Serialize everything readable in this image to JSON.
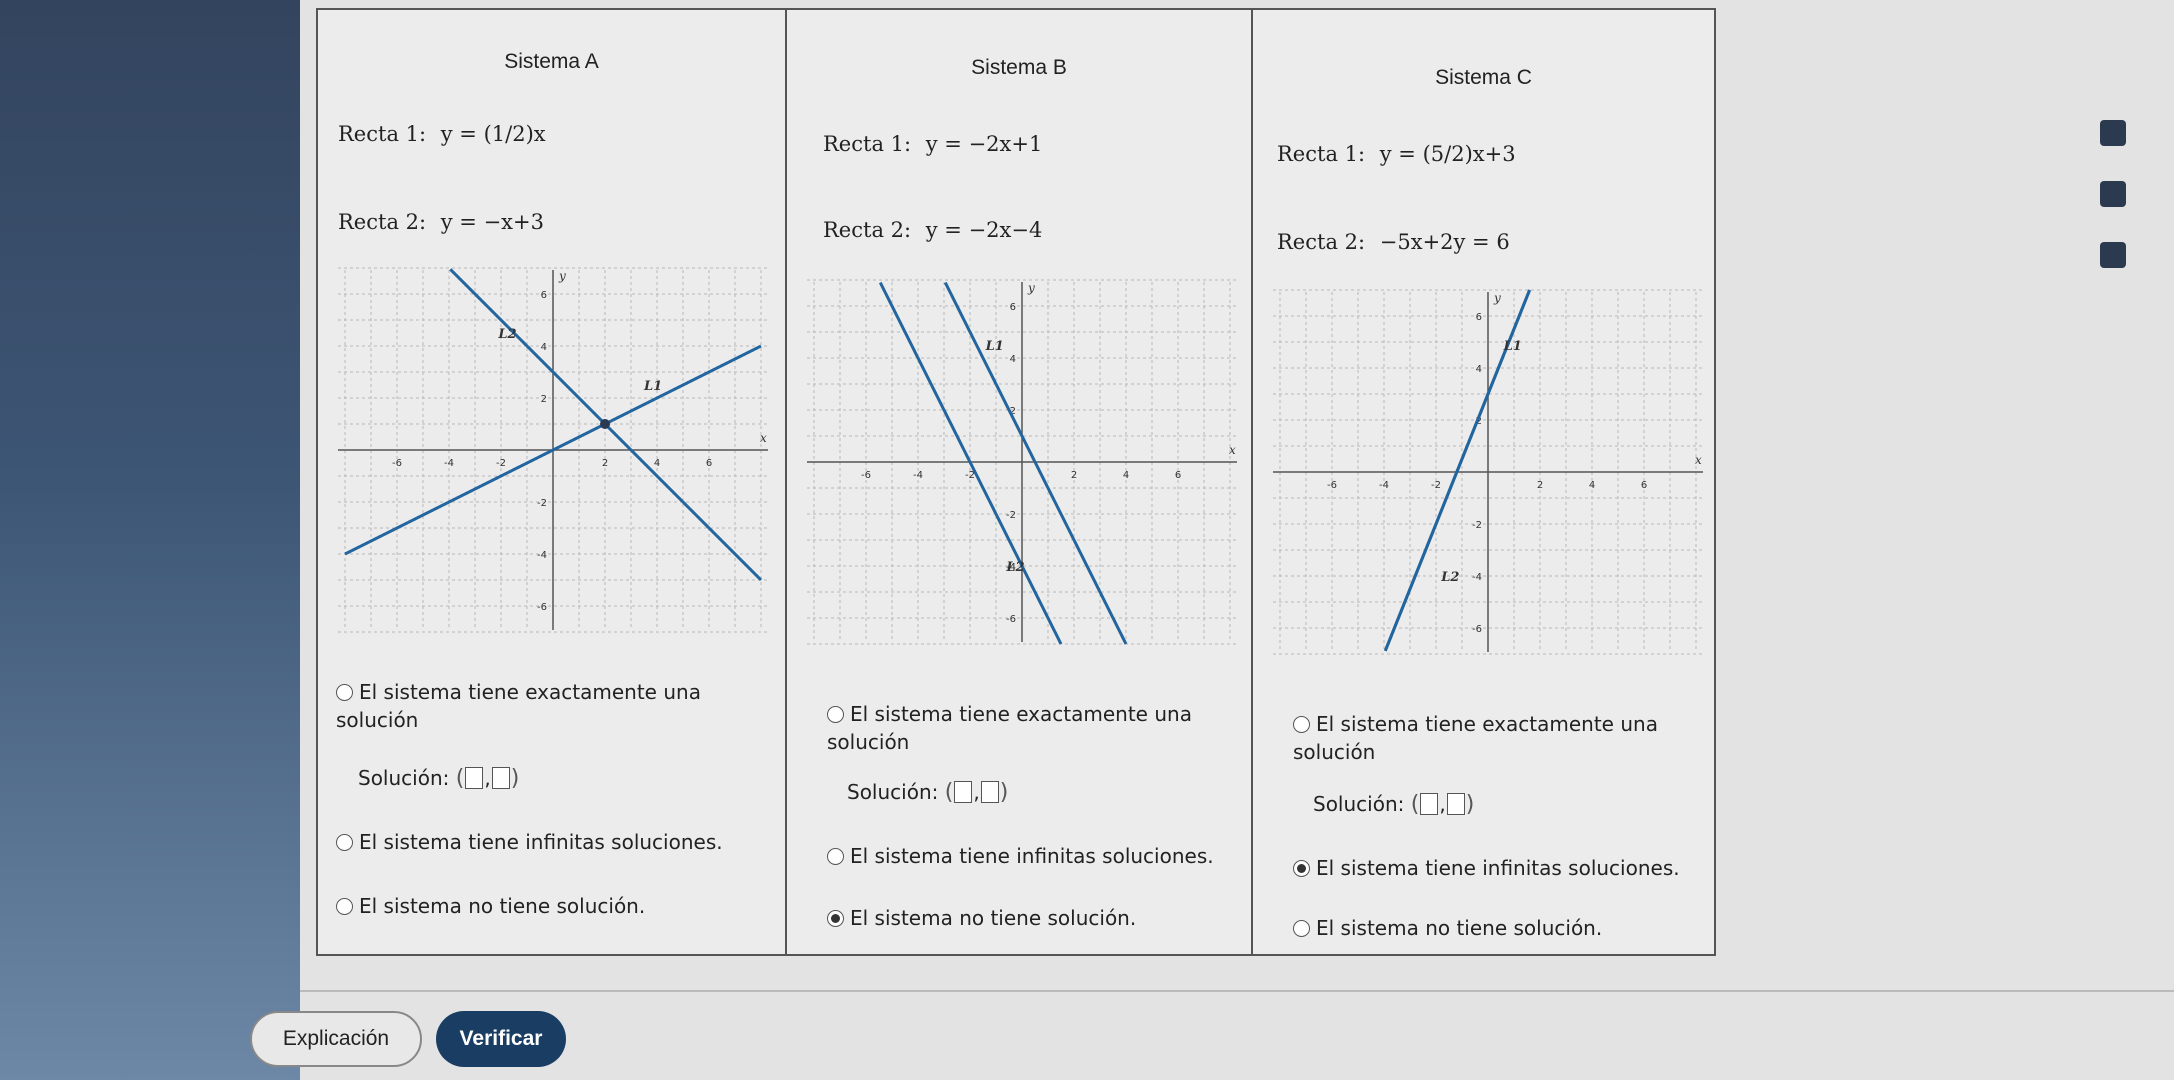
{
  "systems": [
    {
      "title": "Sistema A",
      "line1": {
        "label": "Recta 1:",
        "equation": "y = (1/2)x"
      },
      "line2": {
        "label": "Recta 2:",
        "equation": "y = −x+3"
      },
      "graph_labels": {
        "l1": "L1",
        "l2": "L2"
      },
      "options": {
        "one": "El sistema tiene exactamente una solución",
        "solution_label": "Solución:",
        "infinite": "El sistema tiene infinitas soluciones.",
        "none": "El sistema no tiene solución."
      },
      "selected": "one"
    },
    {
      "title": "Sistema B",
      "line1": {
        "label": "Recta 1:",
        "equation": "y = −2x+1"
      },
      "line2": {
        "label": "Recta 2:",
        "equation": "y = −2x−4"
      },
      "graph_labels": {
        "l1": "L1",
        "l2": "L2"
      },
      "options": {
        "one": "El sistema tiene exactamente una solución",
        "solution_label": "Solución:",
        "infinite": "El sistema tiene infinitas soluciones.",
        "none": "El sistema no tiene solución."
      },
      "selected": "none"
    },
    {
      "title": "Sistema C",
      "line1": {
        "label": "Recta 1:",
        "equation": "y = (5/2)x+3"
      },
      "line2": {
        "label": "Recta 2:",
        "equation": "−5x+2y = 6"
      },
      "graph_labels": {
        "l1": "L1",
        "l2": "L2"
      },
      "options": {
        "one": "El sistema tiene exactamente una solución",
        "solution_label": "Solución:",
        "infinite": "El sistema tiene infinitas soluciones.",
        "none": "El sistema no tiene solución."
      },
      "selected": "infinite"
    }
  ],
  "axis": {
    "x_label": "x",
    "y_label": "y",
    "ticks": [
      "-6",
      "-4",
      "-2",
      "2",
      "4",
      "6"
    ]
  },
  "buttons": {
    "explain": "Explicación",
    "verify": "Verificar"
  },
  "colors": {
    "line": "#23659e",
    "verify_bg": "#1a3e63"
  }
}
